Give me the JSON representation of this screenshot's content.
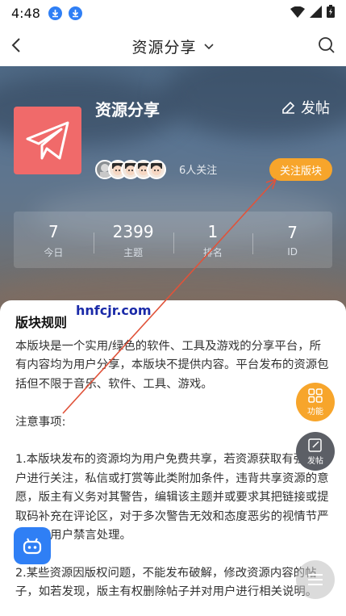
{
  "status_bar": {
    "time": "4:48"
  },
  "header": {
    "title": "资源分享"
  },
  "forum": {
    "name": "资源分享",
    "post_label": "发帖",
    "follow_count": "6人关注",
    "follow_button": "关注版块",
    "stats": [
      {
        "value": "7",
        "label": "今日"
      },
      {
        "value": "2399",
        "label": "主题"
      },
      {
        "value": "1",
        "label": "排名"
      },
      {
        "value": "7",
        "label": "ID"
      }
    ]
  },
  "watermark": "hnfcjr.com",
  "rules": {
    "title": "版块规则",
    "paragraphs": [
      "本版块是一个实用/绿色的软件、工具及游戏的分享平台，所有内容均为用户分享，本版块不提供内容。平台发布的资源包括但不限于音乐、软件、工具、游戏。",
      "注意事项:",
      "1.本版块发布的资源均为用户免费共享，若资源获取有强制用户进行关注，私信或打赏等此类附加条件，违背共享资源的意愿，版主有义务对其警告，编辑该主题并或要求其把链接或提取码补充在评论区，对于多次警告无效和态度恶劣的视情节严重对该用户禁言处理。",
      "2.某些资源因版权问题，不能发布破解，修改资源内容的帖子，如若发现，版主有权删除帖子并对用户进行相关说明。"
    ]
  },
  "fab": {
    "function_label": "功能",
    "post_label": "发帖"
  },
  "colors": {
    "accent": "#f7a52b",
    "logo": "#f06a6a",
    "blue": "#2f7ff5"
  }
}
